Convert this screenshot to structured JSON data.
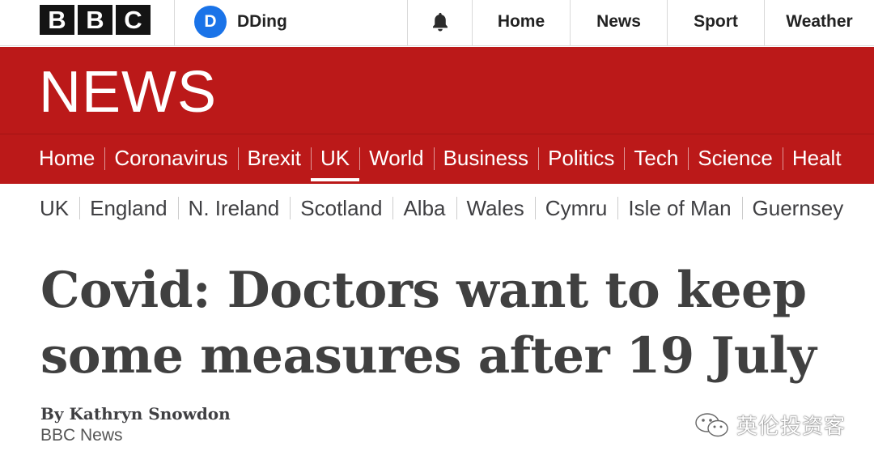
{
  "top_bar": {
    "brand_letters": [
      "B",
      "B",
      "C"
    ],
    "account": {
      "initial": "D",
      "name": "DDing"
    },
    "notifications_icon": "bell-icon",
    "links": [
      "Home",
      "News",
      "Sport",
      "Weather"
    ]
  },
  "masthead": {
    "title": "NEWS"
  },
  "primary_nav": {
    "items": [
      "Home",
      "Coronavirus",
      "Brexit",
      "UK",
      "World",
      "Business",
      "Politics",
      "Tech",
      "Science",
      "Healt"
    ],
    "active": "UK"
  },
  "secondary_nav": {
    "items": [
      "UK",
      "England",
      "N. Ireland",
      "Scotland",
      "Alba",
      "Wales",
      "Cymru",
      "Isle of Man",
      "Guernsey"
    ],
    "active": "UK"
  },
  "article": {
    "headline_line1": "Covid: Doctors want to keep",
    "headline_line2": "some measures after 19 July",
    "author": "By Kathryn Snowdon",
    "source": "BBC News"
  },
  "watermark": {
    "icon": "wechat-icon",
    "text": "英伦投资客"
  },
  "colors": {
    "brand_red": "#bb1919",
    "bbc_black": "#141414",
    "avatar_blue": "#1a73e8",
    "headline_gray": "#404040"
  }
}
